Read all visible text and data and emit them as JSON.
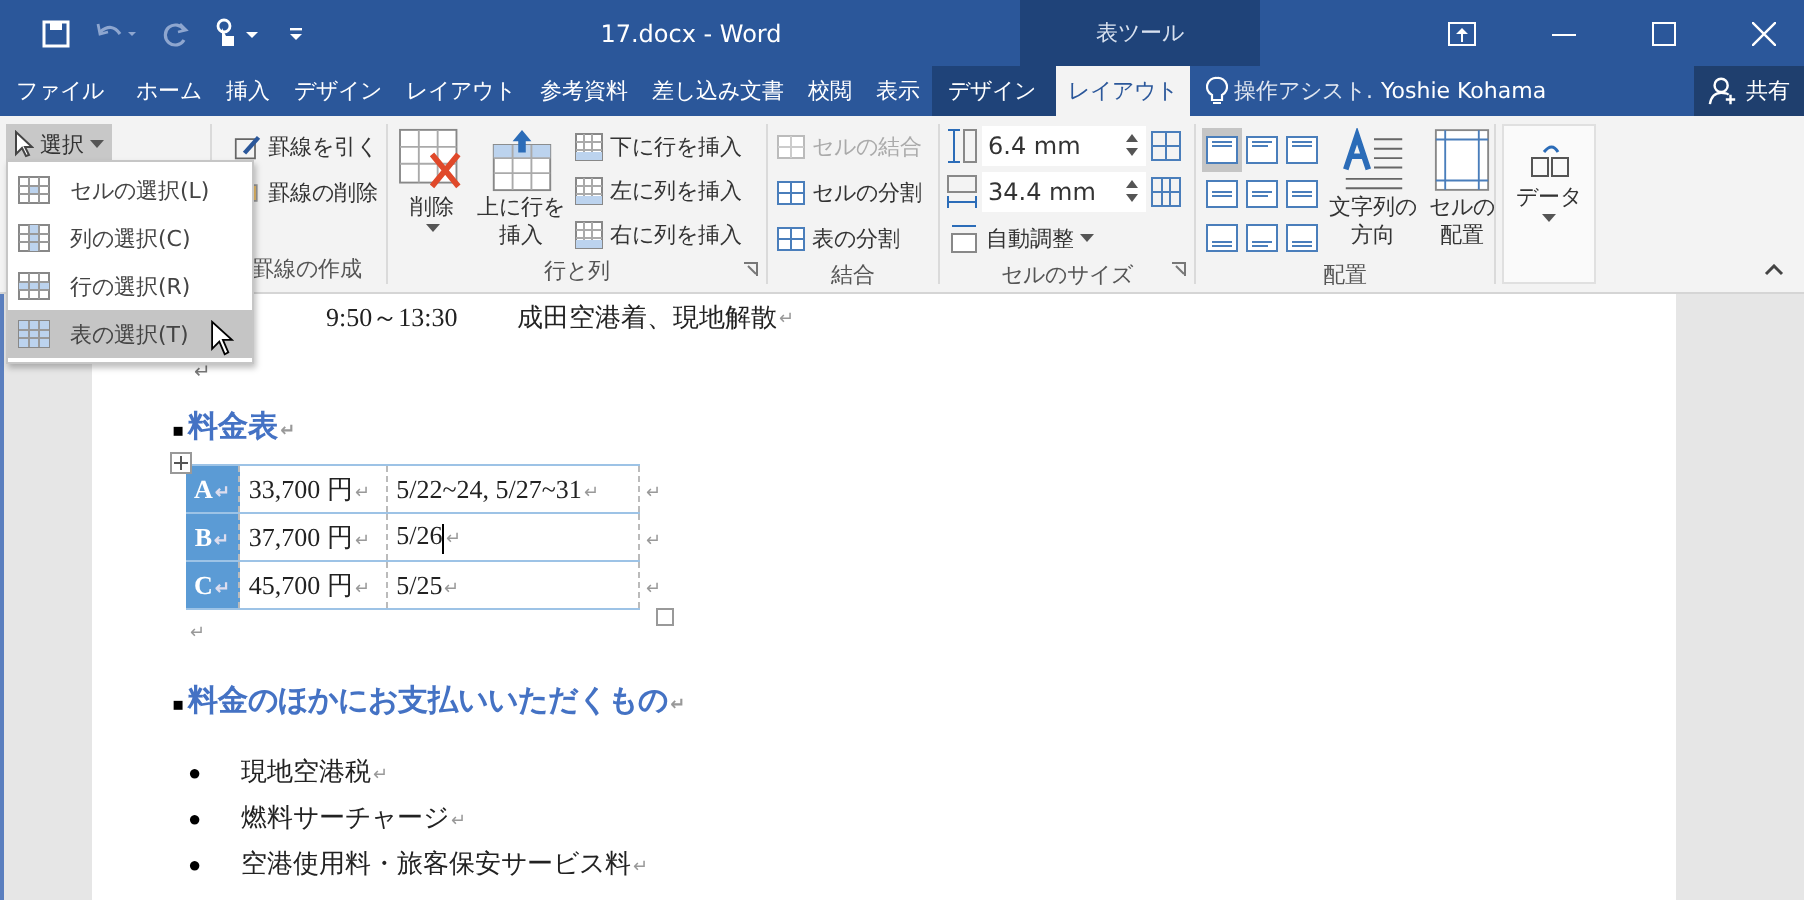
{
  "window": {
    "title": "17.docx - Word",
    "contextual_label": "表ツール"
  },
  "tabs": [
    {
      "label": "ファイル",
      "selected": false,
      "contextual": false
    },
    {
      "label": "ホーム",
      "selected": false,
      "contextual": false
    },
    {
      "label": "挿入",
      "selected": false,
      "contextual": false
    },
    {
      "label": "デザイン",
      "selected": false,
      "contextual": false
    },
    {
      "label": "レイアウト",
      "selected": false,
      "contextual": false
    },
    {
      "label": "参考資料",
      "selected": false,
      "contextual": false
    },
    {
      "label": "差し込み文書",
      "selected": false,
      "contextual": false
    },
    {
      "label": "校閲",
      "selected": false,
      "contextual": false
    },
    {
      "label": "表示",
      "selected": false,
      "contextual": false
    },
    {
      "label": "デザイン",
      "selected": false,
      "contextual": true
    },
    {
      "label": "レイアウト",
      "selected": true,
      "contextual": true
    }
  ],
  "tell_me": "操作アシスト.",
  "user": "Yoshie Kohama",
  "share": "共有",
  "ribbon": {
    "table": {
      "select_button": "選択"
    },
    "draw_borders": {
      "label": "罫線の作成",
      "buttons": [
        "罫線を引く",
        "罫線の削除"
      ]
    },
    "rows_columns": {
      "label": "行と列",
      "delete": "削除",
      "insert_above": "上に行を挿入",
      "small_buttons": [
        "下に行を挿入",
        "左に列を挿入",
        "右に列を挿入"
      ]
    },
    "merge": {
      "label": "結合",
      "buttons": [
        {
          "label": "セルの結合",
          "disabled": true
        },
        {
          "label": "セルの分割",
          "disabled": false
        },
        {
          "label": "表の分割",
          "disabled": false
        }
      ]
    },
    "cell_size": {
      "label": "セルのサイズ",
      "height": "6.4 mm",
      "width": "34.4 mm",
      "autofit": "自動調整"
    },
    "alignment": {
      "label": "配置",
      "cells": [
        {
          "selected": true
        },
        {
          "selected": false
        },
        {
          "selected": false
        },
        {
          "selected": false
        },
        {
          "selected": false
        },
        {
          "selected": false
        },
        {
          "selected": false
        },
        {
          "selected": false
        },
        {
          "selected": false
        }
      ],
      "text_direction": "文字列の方向",
      "cell_margins": "セルの配置"
    },
    "data": {
      "button": "データ"
    }
  },
  "select_menu": {
    "items": [
      {
        "label": "セルの選択(L)",
        "selected": false
      },
      {
        "label": "列の選択(C)",
        "selected": false
      },
      {
        "label": "行の選択(R)",
        "selected": false
      },
      {
        "label": "表の選択(T)",
        "selected": true
      }
    ]
  },
  "document": {
    "schedule": {
      "time": "9:50～13:30",
      "text": "成田空港着、現地解散",
      "mark": "↵"
    },
    "empty_mark_1": "↵",
    "heading_1": {
      "bullet": "▪",
      "text": "料金表",
      "mark": "↵"
    },
    "table": {
      "rows": [
        {
          "label": "A",
          "label_mark": "↵",
          "price": "33,700 円",
          "price_mark": "↵",
          "dates": "5/22~24, 5/27~31",
          "dates_mark": "↵",
          "row_mark": "↵",
          "cursor": false
        },
        {
          "label": "B",
          "label_mark": "↵",
          "price": "37,700 円",
          "price_mark": "↵",
          "dates": "5/26",
          "dates_mark": "↵",
          "row_mark": "↵",
          "cursor": true
        },
        {
          "label": "C",
          "label_mark": "↵",
          "price": "45,700 円",
          "price_mark": "↵",
          "dates": "5/25",
          "dates_mark": "↵",
          "row_mark": "↵",
          "cursor": false
        }
      ]
    },
    "empty_mark_2": "↵",
    "heading_2": {
      "bullet": "▪",
      "text": "料金のほかにお支払いいただくもの",
      "mark": "↵"
    },
    "bullets": [
      {
        "bullet": "●",
        "text": "現地空港税",
        "mark": "↵"
      },
      {
        "bullet": "●",
        "text": "燃料サーチャージ",
        "mark": "↵"
      },
      {
        "bullet": "●",
        "text": "空港使用料・旅客保安サービス料",
        "mark": "↵"
      }
    ]
  }
}
